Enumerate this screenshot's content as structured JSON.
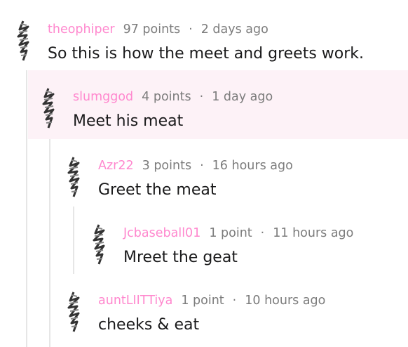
{
  "comments": [
    {
      "user": "theophiper",
      "points": "97 points",
      "sep": "·",
      "time": "2 days ago",
      "body": "So this is how the meet and greets work."
    },
    {
      "user": "slumggod",
      "points": "4 points",
      "sep": "·",
      "time": "1 day ago",
      "body": "Meet his meat"
    },
    {
      "user": "Azr22",
      "points": "3 points",
      "sep": "·",
      "time": "16 hours ago",
      "body": "Greet the meat"
    },
    {
      "user": "Jcbaseball01",
      "points": "1 point",
      "sep": "·",
      "time": "11 hours ago",
      "body": "Mreet the geat"
    },
    {
      "user": "auntLIITTiya",
      "points": "1 point",
      "sep": "·",
      "time": "10 hours ago",
      "body": "cheeks & eat"
    }
  ],
  "colors": {
    "username": "#ff88ce",
    "meta_text": "#7c7c7c",
    "body_text": "#1a1a1b",
    "highlight_bg": "#fdf2f7",
    "thread_line": "#e6e6e6"
  },
  "icons": [
    "squiggle-avatar-icon"
  ]
}
